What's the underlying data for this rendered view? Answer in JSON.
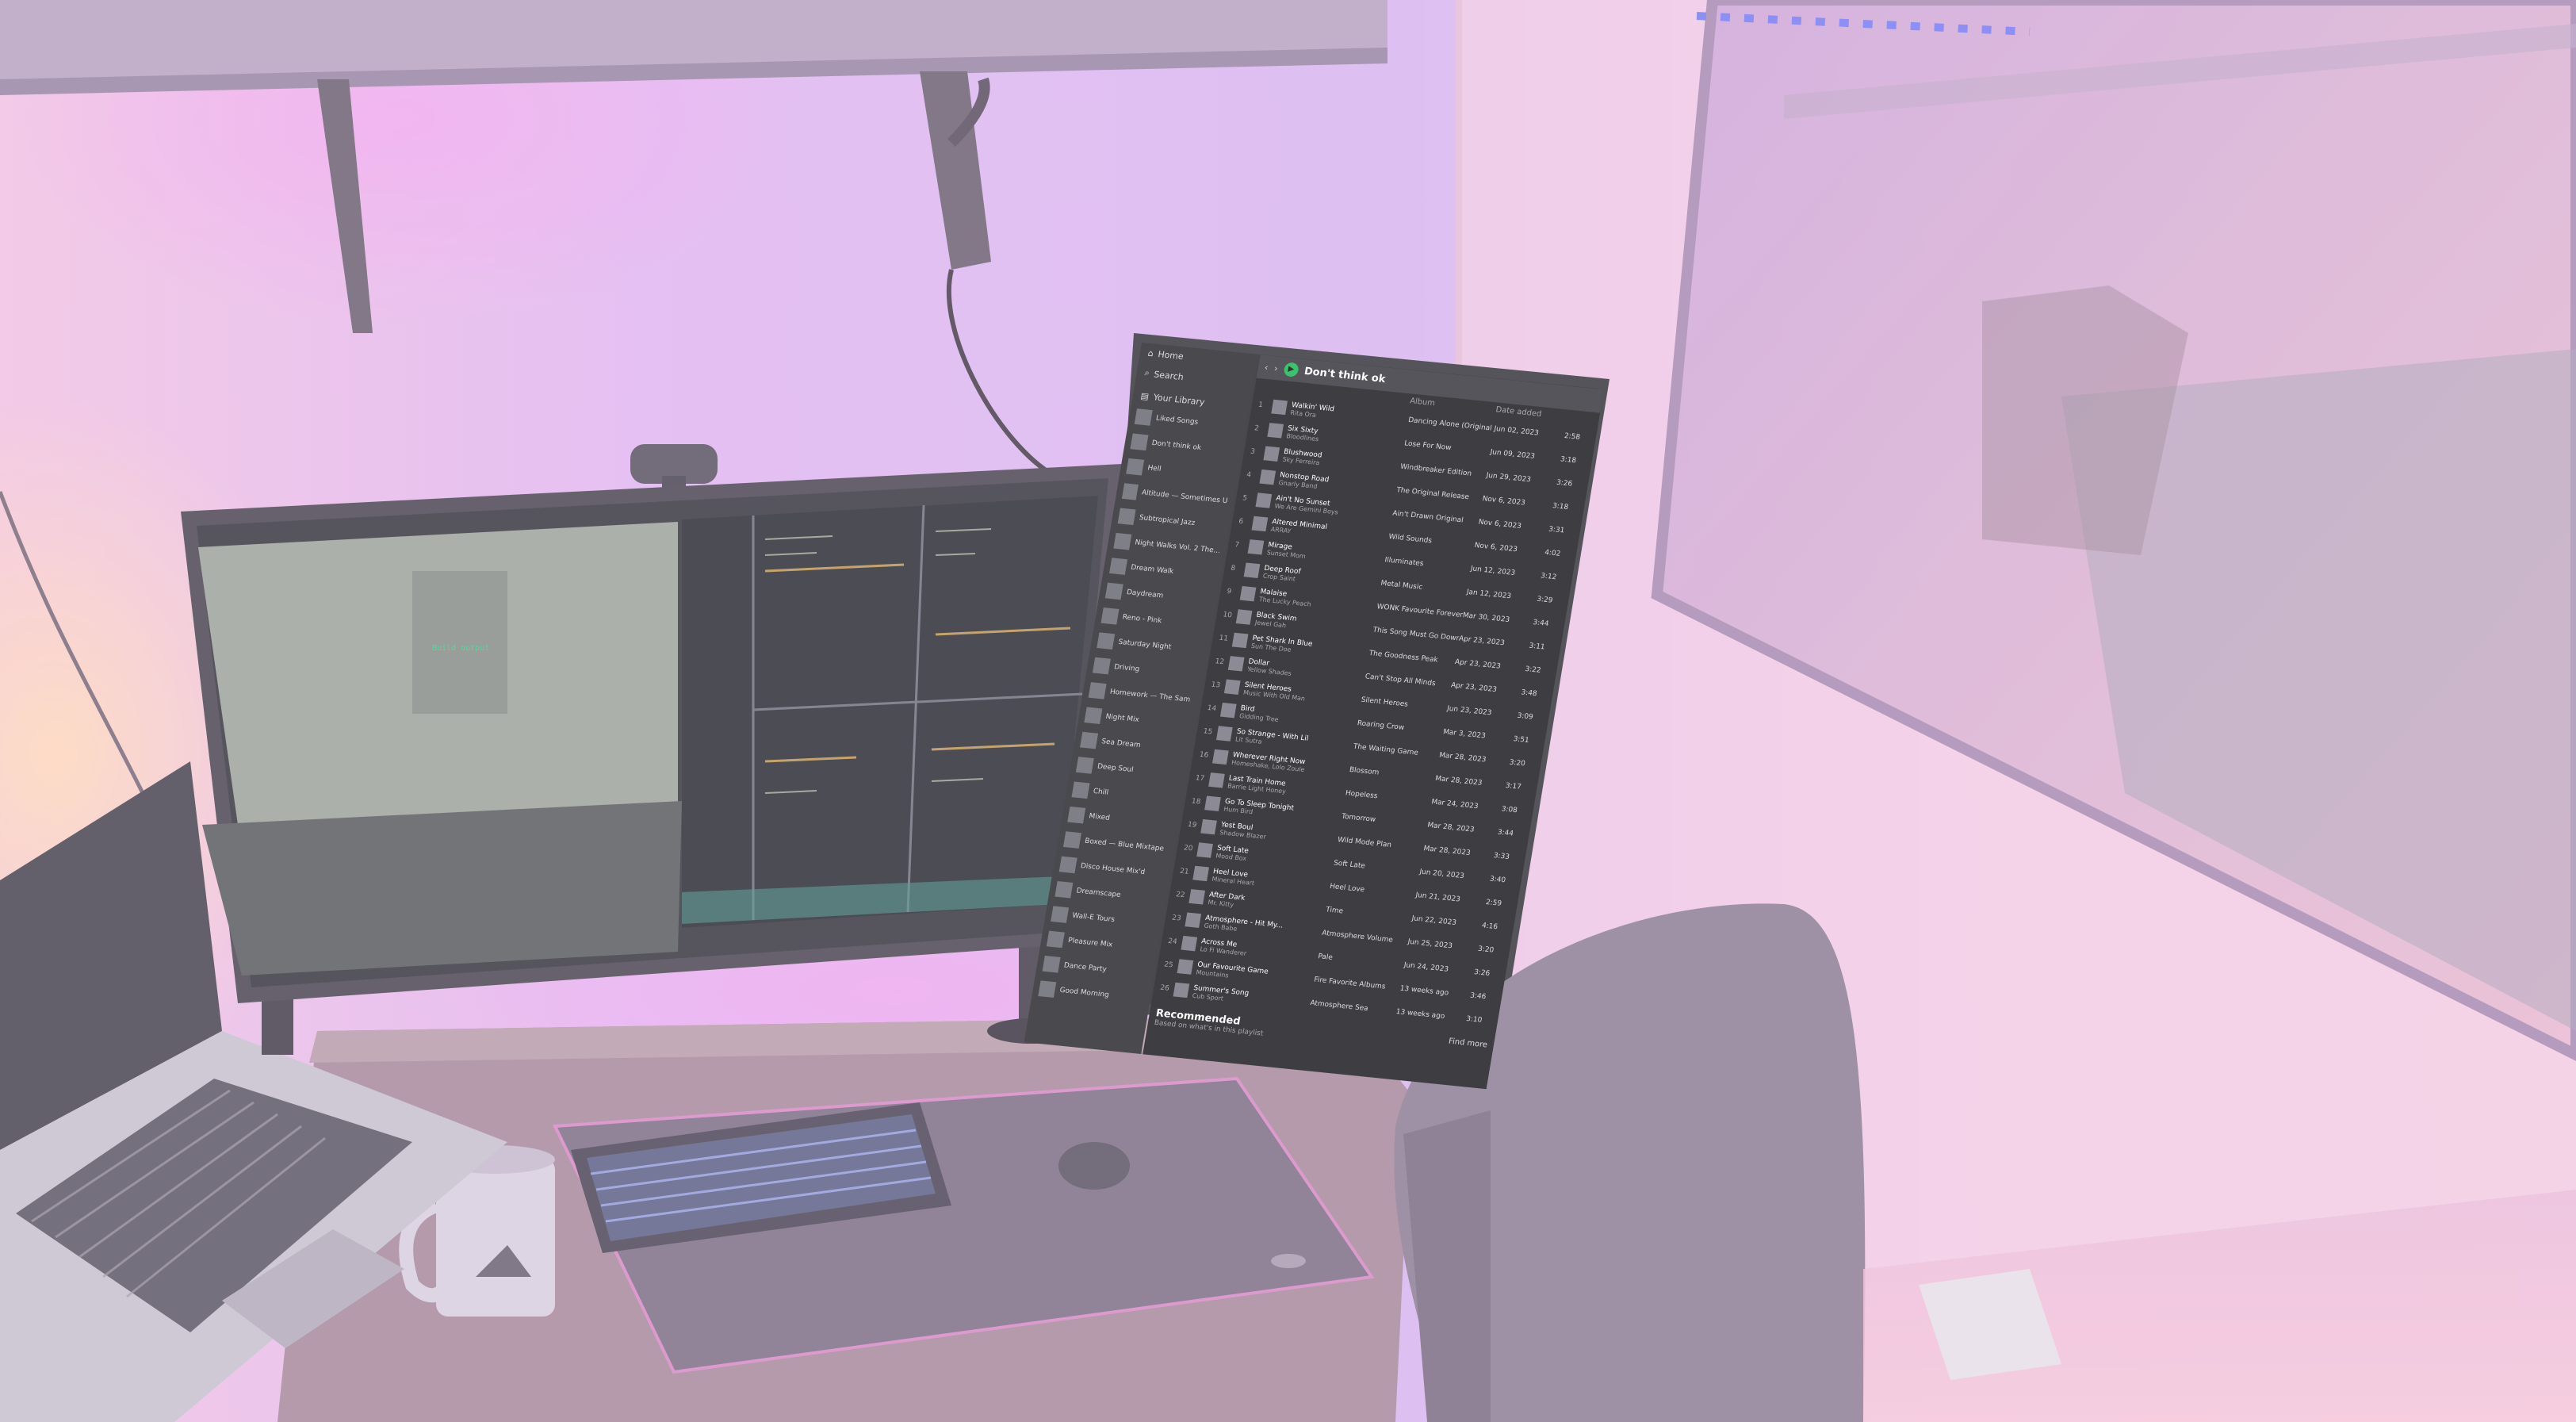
{
  "palette": {
    "wall_left": "#f0c6ef",
    "wall_mid": "#d9b2f1",
    "wall_right": "#f4cde6",
    "shelf": "#b9a3c0",
    "monitor_bezel": "#4e4857",
    "screen_dark": "#3d3b44",
    "screen_grey": "#9fa49f",
    "desk": "#a9879d",
    "desk_mat": "#7e6f86",
    "chair": "#8f7f98",
    "accent_green": "#1db954"
  },
  "spotify": {
    "nav": {
      "home": "Home",
      "search": "Search",
      "library": "Your Library"
    },
    "playlist_title": "Don't think ok",
    "columns": {
      "album": "Album",
      "date": "Date added"
    },
    "tracks": [
      {
        "title": "Walkin' Wild",
        "artist": "Rita Ora",
        "album": "Dancing Alone (Original ...)",
        "date": "Jun 02, 2023",
        "duration": "2:58"
      },
      {
        "title": "Six Sixty",
        "artist": "Bloodlines",
        "album": "Lose For Now",
        "date": "Jun 09, 2023",
        "duration": "3:18"
      },
      {
        "title": "Blushwood",
        "artist": "Sky Ferreira",
        "album": "Windbreaker Edition",
        "date": "Jun 29, 2023",
        "duration": "3:26"
      },
      {
        "title": "Nonstop Road",
        "artist": "Gnarly Band",
        "album": "The Original Release",
        "date": "Nov 6, 2023",
        "duration": "3:18"
      },
      {
        "title": "Ain't No Sunset",
        "artist": "We Are Gemini Boys",
        "album": "Ain't Drawn Original",
        "date": "Nov 6, 2023",
        "duration": "3:31"
      },
      {
        "title": "Altered Minimal",
        "artist": "ARRAY",
        "album": "Wild Sounds",
        "date": "Nov 6, 2023",
        "duration": "4:02"
      },
      {
        "title": "Mirage",
        "artist": "Sunset Mom",
        "album": "Illuminates",
        "date": "Jun 12, 2023",
        "duration": "3:12"
      },
      {
        "title": "Deep Roof",
        "artist": "Crop Saint",
        "album": "Metal Music",
        "date": "Jan 12, 2023",
        "duration": "3:29"
      },
      {
        "title": "Malaise",
        "artist": "The Lucky Peach",
        "album": "WONK Favourite Forever",
        "date": "Mar 30, 2023",
        "duration": "3:44"
      },
      {
        "title": "Black Swim",
        "artist": "Jewel Gah",
        "album": "This Song Must Go Down",
        "date": "Apr 23, 2023",
        "duration": "3:11"
      },
      {
        "title": "Pet Shark In Blue",
        "artist": "Sun The Doe",
        "album": "The Goodness Peak",
        "date": "Apr 23, 2023",
        "duration": "3:22"
      },
      {
        "title": "Dollar",
        "artist": "Yellow Shades",
        "album": "Can't Stop All Minds",
        "date": "Apr 23, 2023",
        "duration": "3:48"
      },
      {
        "title": "Silent Heroes",
        "artist": "Music With Old Man",
        "album": "Silent Heroes",
        "date": "Jun 23, 2023",
        "duration": "3:09"
      },
      {
        "title": "Bird",
        "artist": "Gidding Tree",
        "album": "Roaring Crow",
        "date": "Mar 3, 2023",
        "duration": "3:51"
      },
      {
        "title": "So Strange - With Lil",
        "artist": "Lit Sutra",
        "album": "The Waiting Game",
        "date": "Mar 28, 2023",
        "duration": "3:20"
      },
      {
        "title": "Wherever Right Now",
        "artist": "Homeshake, Lolo Zoule",
        "album": "Blossom",
        "date": "Mar 28, 2023",
        "duration": "3:17"
      },
      {
        "title": "Last Train Home",
        "artist": "Barrie Light Honey",
        "album": "Hopeless",
        "date": "Mar 24, 2023",
        "duration": "3:08"
      },
      {
        "title": "Go To Sleep Tonight",
        "artist": "Hum Bird",
        "album": "Tomorrow",
        "date": "Mar 28, 2023",
        "duration": "3:44"
      },
      {
        "title": "Yest Boul",
        "artist": "Shadow Blazer",
        "album": "Wild Mode Plan",
        "date": "Mar 28, 2023",
        "duration": "3:33"
      },
      {
        "title": "Soft Late",
        "artist": "Mood Box",
        "album": "Soft Late",
        "date": "Jun 20, 2023",
        "duration": "3:40"
      },
      {
        "title": "Heel Love",
        "artist": "Mineral Heart",
        "album": "Heel Love",
        "date": "Jun 21, 2023",
        "duration": "2:59"
      },
      {
        "title": "After Dark",
        "artist": "Mr. Kitty",
        "album": "Time",
        "date": "Jun 22, 2023",
        "duration": "4:16"
      },
      {
        "title": "Atmosphere - Hit My...",
        "artist": "Goth Babe",
        "album": "Atmosphere Volume",
        "date": "Jun 25, 2023",
        "duration": "3:20"
      },
      {
        "title": "Across Me",
        "artist": "Lo Fi Wanderer",
        "album": "Pale",
        "date": "Jun 24, 2023",
        "duration": "3:26"
      },
      {
        "title": "Our Favourite Game",
        "artist": "Mountains",
        "album": "Fire Favorite Albums",
        "date": "13 weeks ago",
        "duration": "3:46"
      },
      {
        "title": "Summer's Song",
        "artist": "Cub Sport",
        "album": "Atmosphere Sea",
        "date": "13 weeks ago",
        "duration": "3:10"
      }
    ],
    "recommended_title": "Recommended",
    "recommended_subtitle": "Based on what's in this playlist",
    "find_more": "Find more",
    "library_items": [
      "Liked Songs",
      "Don't think ok",
      "Hell",
      "Altitude — Sometimes Un...",
      "Subtropical Jazz",
      "Night Walks Vol. 2 The...",
      "Dream Walk",
      "Daydream",
      "Reno - Pink",
      "Saturday Night",
      "Driving",
      "Homework — The Sam",
      "Night Mix",
      "Sea Dream",
      "Deep Soul",
      "Chill",
      "Mixed",
      "Boxed — Blue Mixtape",
      "Disco House Mix'd",
      "Dreamscape",
      "Wall-E Tours",
      "Pleasure Mix",
      "Dance Party",
      "Good Morning"
    ]
  },
  "ide": {
    "left_pane_text": "Build output",
    "status": "ready"
  },
  "objects": {
    "webcam": "webcam",
    "mug": "mug",
    "keyboard": "mechanical keyboard",
    "laptop": "laptop",
    "mouse_pad": "desk mat"
  }
}
